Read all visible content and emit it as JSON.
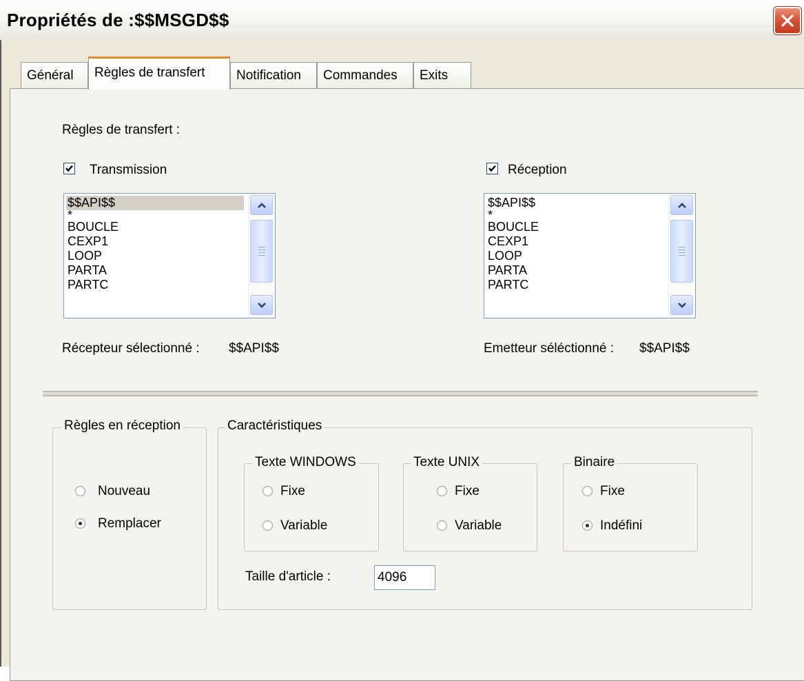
{
  "window": {
    "title": "Propriétés de :$$MSGD$$"
  },
  "tabs": [
    {
      "label": "Général",
      "active": false
    },
    {
      "label": "Règles de transfert",
      "active": true
    },
    {
      "label": "Notification",
      "active": false
    },
    {
      "label": "Commandes",
      "active": false
    },
    {
      "label": "Exits",
      "active": false
    }
  ],
  "transfer": {
    "heading": "Règles de transfert :",
    "transmission": {
      "label": "Transmission",
      "checked": true,
      "items": [
        "$$API$$",
        "*",
        "BOUCLE",
        "CEXP1",
        "LOOP",
        "PARTA",
        "PARTC"
      ],
      "selected_index": 0,
      "selected_label": "Récepteur sélectionné :",
      "selected_value": "$$API$$"
    },
    "reception": {
      "label": "Réception",
      "checked": true,
      "items": [
        "$$API$$",
        "*",
        "BOUCLE",
        "CEXP1",
        "LOOP",
        "PARTA",
        "PARTC"
      ],
      "selected_label": "Emetteur séléctionné :",
      "selected_value": "$$API$$"
    }
  },
  "reception_rules": {
    "legend": "Règles en réception",
    "options": [
      {
        "label": "Nouveau",
        "checked": false
      },
      {
        "label": "Remplacer",
        "checked": true
      }
    ]
  },
  "characteristics": {
    "legend": "Caractéristiques",
    "windows": {
      "legend": "Texte WINDOWS",
      "options": [
        {
          "label": "Fixe",
          "checked": false
        },
        {
          "label": "Variable",
          "checked": false
        }
      ]
    },
    "unix": {
      "legend": "Texte UNIX",
      "options": [
        {
          "label": "Fixe",
          "checked": false
        },
        {
          "label": "Variable",
          "checked": false
        }
      ]
    },
    "binary": {
      "legend": "Binaire",
      "options": [
        {
          "label": "Fixe",
          "checked": false
        },
        {
          "label": "Indéfini",
          "checked": true
        }
      ]
    },
    "article_size": {
      "label": "Taille d'article :",
      "value": "4096"
    }
  },
  "icons": {
    "close": "close-icon",
    "scroll_up": "chevron-up-icon",
    "scroll_down": "chevron-down-icon",
    "check": "check-icon"
  },
  "colors": {
    "active_tab_accent": "#e68b2c",
    "close_button": "#d8553a",
    "dialog_bg": "#ece9d8"
  }
}
